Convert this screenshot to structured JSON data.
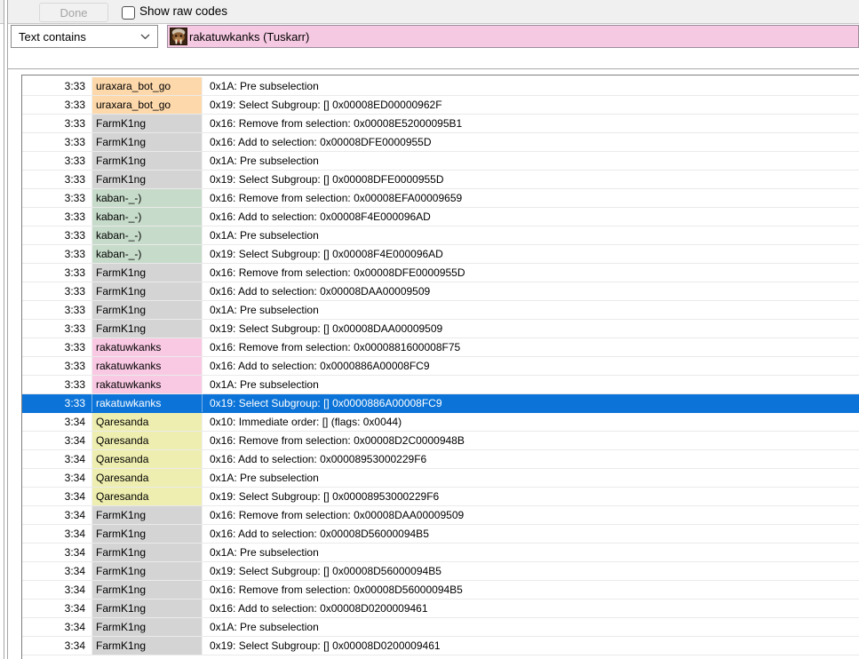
{
  "toolbar": {
    "done_label": "Done",
    "show_raw_codes_label": "Show raw codes",
    "checkbox_checked": false
  },
  "filter": {
    "operator": "Text contains",
    "value": "rakatuwkanks (Tuskarr)",
    "value_bg": "#f6c9e2",
    "avatar_icon": "tuskarr-hero-icon",
    "dropdown_icon": "chevron-down-icon"
  },
  "colors": {
    "toolbar_bg": "#f0f0f0",
    "selection_bg": "#0c74d8",
    "selection_text": "#ffffff",
    "players": {
      "uraxara_bot_go": "#fcd8ab",
      "FarmK1ng": "#d4d4d4",
      "kaban-_-)": "#c6dbc9",
      "rakatuwkanks": "#f9c9e3",
      "Qaresanda": "#eeeeb0"
    }
  },
  "log": {
    "selected_index": 17,
    "rows": [
      {
        "time": "3:33",
        "player": "uraxara_bot_go",
        "action": "0x1A: Pre subselection"
      },
      {
        "time": "3:33",
        "player": "uraxara_bot_go",
        "action": "0x19: Select Subgroup: [] 0x00008ED00000962F"
      },
      {
        "time": "3:33",
        "player": "FarmK1ng",
        "action": "0x16: Remove from selection: 0x00008E52000095B1"
      },
      {
        "time": "3:33",
        "player": "FarmK1ng",
        "action": "0x16: Add to selection: 0x00008DFE0000955D"
      },
      {
        "time": "3:33",
        "player": "FarmK1ng",
        "action": "0x1A: Pre subselection"
      },
      {
        "time": "3:33",
        "player": "FarmK1ng",
        "action": "0x19: Select Subgroup: [] 0x00008DFE0000955D"
      },
      {
        "time": "3:33",
        "player": "kaban-_-)",
        "action": "0x16: Remove from selection: 0x00008EFA00009659"
      },
      {
        "time": "3:33",
        "player": "kaban-_-)",
        "action": "0x16: Add to selection: 0x00008F4E000096AD"
      },
      {
        "time": "3:33",
        "player": "kaban-_-)",
        "action": "0x1A: Pre subselection"
      },
      {
        "time": "3:33",
        "player": "kaban-_-)",
        "action": "0x19: Select Subgroup: [] 0x00008F4E000096AD"
      },
      {
        "time": "3:33",
        "player": "FarmK1ng",
        "action": "0x16: Remove from selection: 0x00008DFE0000955D"
      },
      {
        "time": "3:33",
        "player": "FarmK1ng",
        "action": "0x16: Add to selection: 0x00008DAA00009509"
      },
      {
        "time": "3:33",
        "player": "FarmK1ng",
        "action": "0x1A: Pre subselection"
      },
      {
        "time": "3:33",
        "player": "FarmK1ng",
        "action": "0x19: Select Subgroup: [] 0x00008DAA00009509"
      },
      {
        "time": "3:33",
        "player": "rakatuwkanks",
        "action": "0x16: Remove from selection: 0x0000881600008F75"
      },
      {
        "time": "3:33",
        "player": "rakatuwkanks",
        "action": "0x16: Add to selection: 0x0000886A00008FC9"
      },
      {
        "time": "3:33",
        "player": "rakatuwkanks",
        "action": "0x1A: Pre subselection"
      },
      {
        "time": "3:33",
        "player": "rakatuwkanks",
        "action": "0x19: Select Subgroup: [] 0x0000886A00008FC9"
      },
      {
        "time": "3:34",
        "player": "Qaresanda",
        "action": "0x10: Immediate order: [] (flags: 0x0044)"
      },
      {
        "time": "3:34",
        "player": "Qaresanda",
        "action": "0x16: Remove from selection: 0x00008D2C0000948B"
      },
      {
        "time": "3:34",
        "player": "Qaresanda",
        "action": "0x16: Add to selection: 0x00008953000229F6"
      },
      {
        "time": "3:34",
        "player": "Qaresanda",
        "action": "0x1A: Pre subselection"
      },
      {
        "time": "3:34",
        "player": "Qaresanda",
        "action": "0x19: Select Subgroup: [] 0x00008953000229F6"
      },
      {
        "time": "3:34",
        "player": "FarmK1ng",
        "action": "0x16: Remove from selection: 0x00008DAA00009509"
      },
      {
        "time": "3:34",
        "player": "FarmK1ng",
        "action": "0x16: Add to selection: 0x00008D56000094B5"
      },
      {
        "time": "3:34",
        "player": "FarmK1ng",
        "action": "0x1A: Pre subselection"
      },
      {
        "time": "3:34",
        "player": "FarmK1ng",
        "action": "0x19: Select Subgroup: [] 0x00008D56000094B5"
      },
      {
        "time": "3:34",
        "player": "FarmK1ng",
        "action": "0x16: Remove from selection: 0x00008D56000094B5"
      },
      {
        "time": "3:34",
        "player": "FarmK1ng",
        "action": "0x16: Add to selection: 0x00008D0200009461"
      },
      {
        "time": "3:34",
        "player": "FarmK1ng",
        "action": "0x1A: Pre subselection"
      },
      {
        "time": "3:34",
        "player": "FarmK1ng",
        "action": "0x19: Select Subgroup: [] 0x00008D0200009461"
      }
    ]
  }
}
